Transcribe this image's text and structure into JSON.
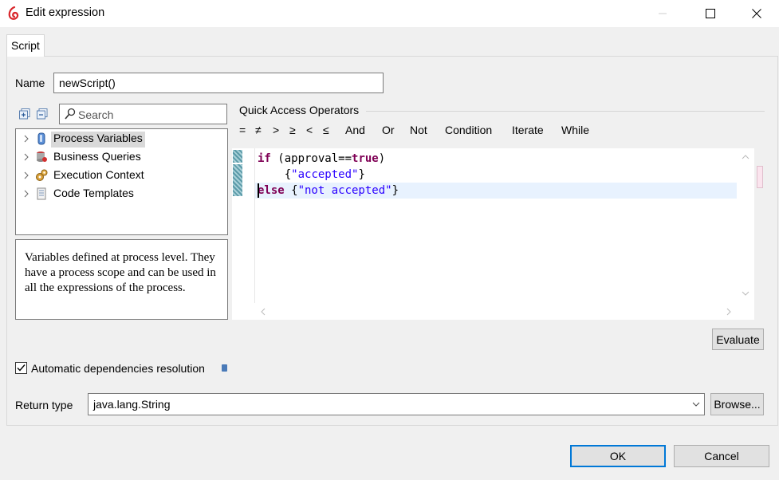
{
  "window": {
    "title": "Edit expression"
  },
  "tabs": [
    {
      "label": "Script"
    }
  ],
  "name_field": {
    "label": "Name",
    "value": "newScript()"
  },
  "tree_toolbar": {
    "expand_icon": "expand-all-icon",
    "collapse_icon": "collapse-all-icon",
    "search_placeholder": "Search"
  },
  "tree": {
    "items": [
      {
        "label": "Process Variables",
        "icon": "database-icon",
        "selected": true
      },
      {
        "label": "Business Queries",
        "icon": "query-icon",
        "selected": false
      },
      {
        "label": "Execution Context",
        "icon": "gears-icon",
        "selected": false
      },
      {
        "label": "Code Templates",
        "icon": "document-icon",
        "selected": false
      }
    ]
  },
  "description": "Variables defined at process level. They have a process scope and can be used in all the expressions of the process.",
  "quick_access": {
    "title": "Quick Access Operators",
    "operators": [
      "=",
      "≠",
      ">",
      "≥",
      "<",
      "≤",
      "And",
      "Or",
      "Not",
      "Condition",
      "Iterate",
      "While"
    ]
  },
  "editor": {
    "lines": [
      [
        {
          "t": "if",
          "c": "kw"
        },
        {
          "t": " (approval==",
          "c": ""
        },
        {
          "t": "true",
          "c": "kw"
        },
        {
          "t": ")",
          "c": ""
        }
      ],
      [
        {
          "t": "    {",
          "c": ""
        },
        {
          "t": "\"accepted\"",
          "c": "str"
        },
        {
          "t": "}",
          "c": ""
        }
      ],
      [
        {
          "t": "else",
          "c": "kw"
        },
        {
          "t": " {",
          "c": ""
        },
        {
          "t": "\"not accepted\"",
          "c": "str"
        },
        {
          "t": "}",
          "c": ""
        }
      ]
    ]
  },
  "buttons": {
    "evaluate": "Evaluate",
    "browse": "Browse...",
    "ok": "OK",
    "cancel": "Cancel"
  },
  "auto_dependencies": {
    "label": "Automatic dependencies resolution",
    "checked": true
  },
  "return_type": {
    "label": "Return type",
    "value": "java.lang.String"
  },
  "colors": {
    "keyword": "#7f0055",
    "string": "#2a00ff",
    "current_line": "#e8f2fe",
    "ok_border": "#0078d7"
  }
}
